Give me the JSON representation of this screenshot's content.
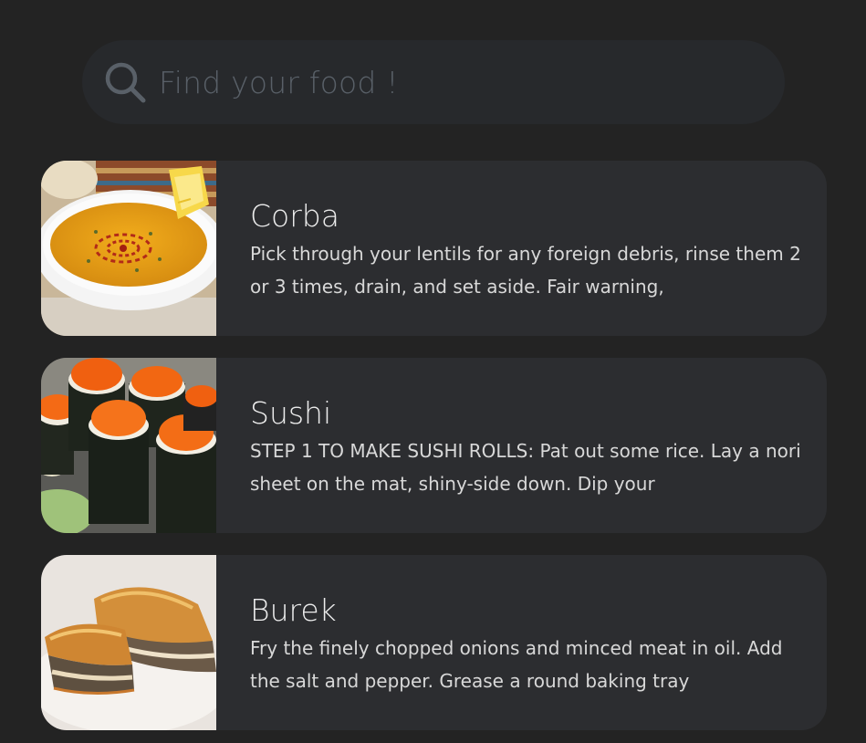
{
  "search": {
    "icon": "search-icon",
    "placeholder": "Find your food !",
    "value": ""
  },
  "meals": [
    {
      "name": "Corba",
      "image": "soup-bowl-thumbnail",
      "description": "Pick through your lentils for any foreign debris, rinse them 2 or 3 times, drain, and set aside. Fair warning,"
    },
    {
      "name": "Sushi",
      "image": "sushi-rolls-thumbnail",
      "description": "STEP 1 TO MAKE SUSHI ROLLS: Pat out some rice. Lay a nori sheet on the mat, shiny-side down. Dip your"
    },
    {
      "name": "Burek",
      "image": "burek-pastry-thumbnail",
      "description": "Fry the finely chopped onions and minced meat in oil. Add the salt and pepper. Grease a round baking tray"
    }
  ],
  "colors": {
    "background": "#232323",
    "search_bar": "#27292c",
    "card": "#2c2d30",
    "placeholder": "#596068",
    "title_text": "#ececec",
    "body_text": "#d8d8d8"
  }
}
